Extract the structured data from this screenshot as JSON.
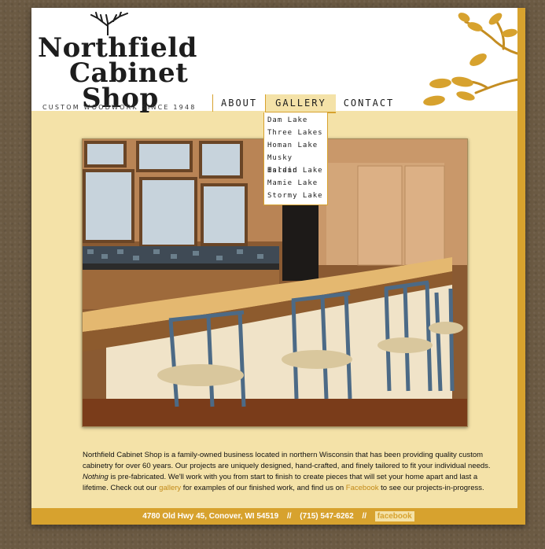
{
  "logo": {
    "line1": "Northfield",
    "line2": "Cabinet",
    "line3": "Shop",
    "tagline": "Custom woodwork since 1948"
  },
  "nav": {
    "items": [
      {
        "label": "About"
      },
      {
        "label": "Gallery"
      },
      {
        "label": "Contact"
      }
    ]
  },
  "dropdown": {
    "items": [
      {
        "label": "Dam Lake"
      },
      {
        "label": "Three Lakes"
      },
      {
        "label": "Homan Lake"
      },
      {
        "label": "Musky Island"
      },
      {
        "label": "Hardin Lake"
      },
      {
        "label": "Mamie Lake"
      },
      {
        "label": "Stormy Lake"
      }
    ]
  },
  "description": {
    "part1": "Northfield Cabinet Shop is a family-owned business located in northern Wisconsin that has been providing quality custom cabinetry for over 60 years. Our projects are uniquely designed, hand-crafted, and finely tailored to fit your individual needs. ",
    "nothing": "Nothing",
    "part2": " is pre-fabricated. We'll work with you from start to finish to create pieces that will set your home apart and last a lifetime. Check out our ",
    "gallery_link": "gallery",
    "part3": " for examples of our finished work, and find us on ",
    "facebook_link": "Facebook",
    "part4": " to see our projects-in-progress."
  },
  "footer": {
    "address": "4780 Old Hwy 45, Conover, WI 54519",
    "sep1": "//",
    "phone": "(715) 547-6262",
    "sep2": "//",
    "facebook": "facebook"
  },
  "colors": {
    "accent": "#d7a22e",
    "page_bg": "#f4e2a8",
    "background": "#6b5a43"
  }
}
